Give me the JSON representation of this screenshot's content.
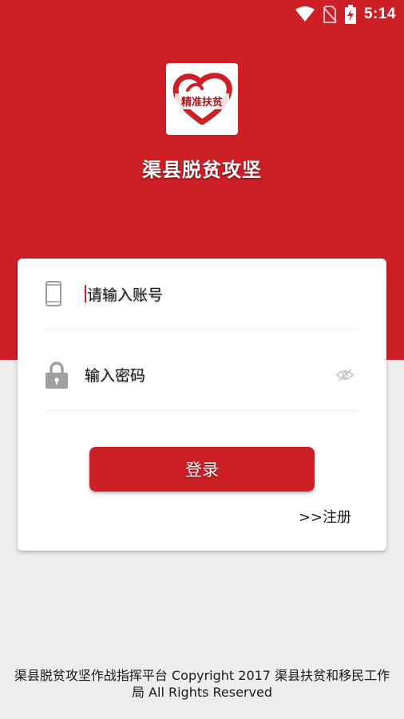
{
  "status_bar": {
    "time": "5:14",
    "icons": [
      "wifi-icon",
      "no-sim-icon",
      "battery-charging-icon"
    ]
  },
  "app": {
    "logo_text": "精准扶贫",
    "title": "渠县脱贫攻坚"
  },
  "login_form": {
    "account_placeholder": "请输入账号",
    "password_placeholder": "输入密码",
    "login_label": "登录",
    "register_label": ">>注册"
  },
  "footer": {
    "line1": "渠县脱贫攻坚作战指挥平台 Copyright 2017 渠县扶贫和移民工作",
    "line2": "局 All Rights Reserved"
  },
  "colors": {
    "brand_red": "#cc1f26",
    "background_gray": "#ededed",
    "card_white": "#ffffff"
  }
}
